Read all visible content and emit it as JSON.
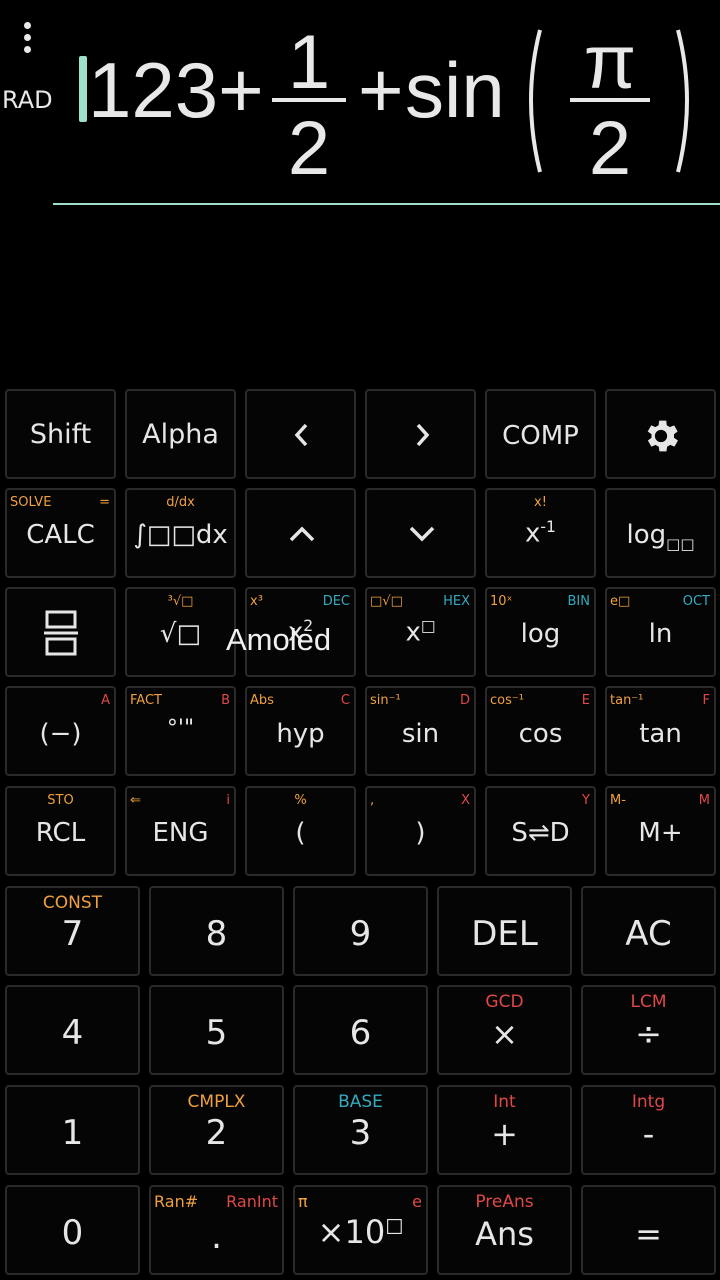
{
  "display": {
    "mode": "RAD",
    "expression": {
      "prefix": "123+",
      "frac1": {
        "num": "1",
        "den": "2"
      },
      "plus": "+",
      "func": "sin",
      "frac2": {
        "num": "π",
        "den": "2"
      }
    }
  },
  "overlay": "Amoled",
  "colors": {
    "cursor": "#9fe0c8",
    "shift": "#f0a040",
    "alpha": "#e04848",
    "mode": "#33aabf"
  },
  "keys": {
    "shift": "Shift",
    "alpha": "Alpha",
    "left": "<",
    "right": ">",
    "comp": "COMP",
    "settings_icon": "gear-icon",
    "calc": {
      "main": "CALC",
      "shift": "SOLVE",
      "alpha": "="
    },
    "integral": {
      "main": "∫□□dx",
      "shift": "d/dx"
    },
    "up": "^",
    "down": "v",
    "inverse": {
      "main": "x",
      "sup": "-1",
      "shift": "x!"
    },
    "logbase": {
      "main": "log",
      "sub": "□□"
    },
    "frac": {
      "icon": "fraction-icon"
    },
    "sqrt": {
      "main": "√□",
      "shift": "³√□"
    },
    "square": {
      "main": "x",
      "sup": "2",
      "shift": "x³",
      "mode": "DEC"
    },
    "power": {
      "main": "x",
      "sup": "□",
      "shift": "□√□",
      "mode": "HEX"
    },
    "log": {
      "main": "log",
      "shift": "10ˣ",
      "mode": "BIN"
    },
    "ln": {
      "main": "ln",
      "shift": "e□",
      "mode": "OCT"
    },
    "neg": {
      "main": "(−)",
      "alpha": "A"
    },
    "deg": {
      "main": "°'\"",
      "shift": "FACT",
      "alpha": "B"
    },
    "hyp": {
      "main": "hyp",
      "shift": "Abs",
      "alpha": "C"
    },
    "sin": {
      "main": "sin",
      "shift": "sin⁻¹",
      "alpha": "D"
    },
    "cos": {
      "main": "cos",
      "shift": "cos⁻¹",
      "alpha": "E"
    },
    "tan": {
      "main": "tan",
      "shift": "tan⁻¹",
      "alpha": "F"
    },
    "rcl": {
      "main": "RCL",
      "shift": "STO"
    },
    "eng": {
      "main": "ENG",
      "shift": "⇐",
      "alpha": "i"
    },
    "lparen": {
      "main": "(",
      "shift": "%"
    },
    "rparen": {
      "main": ")",
      "shift": ",",
      "alpha": "X"
    },
    "sd": {
      "main": "S⇌D",
      "alpha": "Y"
    },
    "mplus": {
      "main": "M+",
      "shift": "M-",
      "alpha": "M"
    },
    "seven": {
      "main": "7",
      "shift": "CONST"
    },
    "eight": "8",
    "nine": "9",
    "del": "DEL",
    "ac": "AC",
    "four": "4",
    "five": "5",
    "six": "6",
    "mul": {
      "main": "×",
      "shift": "GCD"
    },
    "div": {
      "main": "÷",
      "shift": "LCM"
    },
    "one": "1",
    "two": {
      "main": "2",
      "shift": "CMPLX"
    },
    "three": {
      "main": "3",
      "mode": "BASE"
    },
    "plus": {
      "main": "+",
      "shift": "Int"
    },
    "minus": {
      "main": "-",
      "shift": "Intg"
    },
    "zero": "0",
    "dot": {
      "main": ".",
      "shift": "Ran#",
      "alpha": "RanInt"
    },
    "exp": {
      "main": "×10",
      "sup": "□",
      "shift": "π",
      "alpha": "e"
    },
    "ans": {
      "main": "Ans",
      "shift": "PreAns"
    },
    "equals": "="
  }
}
